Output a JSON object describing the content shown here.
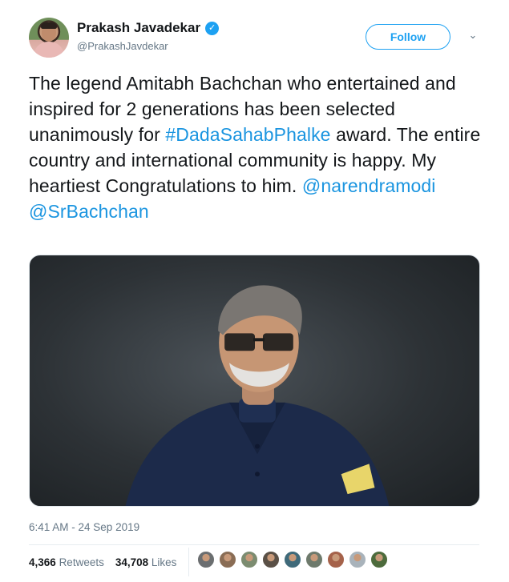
{
  "author": {
    "display_name": "Prakash Javadekar",
    "handle": "@PrakashJavdekar",
    "verified": true
  },
  "follow_button": {
    "label": "Follow"
  },
  "tweet": {
    "text_1": "The legend Amitabh Bachchan who entertained and inspired for 2 generations has been selected unanimously for ",
    "hashtag": "#DadaSahabPhalke",
    "text_2": " award. The entire country and international community is happy. My heartiest Congratulations to him. ",
    "mention_1": "@narendramodi",
    "mention_2": "@SrBachchan",
    "timestamp": "6:41 AM - 24 Sep 2019"
  },
  "stats": {
    "retweets_count": "4,366",
    "retweets_label": "Retweets",
    "likes_count": "34,708",
    "likes_label": "Likes"
  },
  "likers": [
    {
      "color": "#6b6e70"
    },
    {
      "color": "#8a6d55"
    },
    {
      "color": "#7c8c70"
    },
    {
      "color": "#5a5046"
    },
    {
      "color": "#3f6a7a"
    },
    {
      "color": "#6e7a6c"
    },
    {
      "color": "#a5624a"
    },
    {
      "color": "#a9b3bb"
    },
    {
      "color": "#4d6b3c"
    }
  ],
  "colors": {
    "accent": "#1da1f2",
    "link": "#1b95e0",
    "muted": "#657786"
  }
}
